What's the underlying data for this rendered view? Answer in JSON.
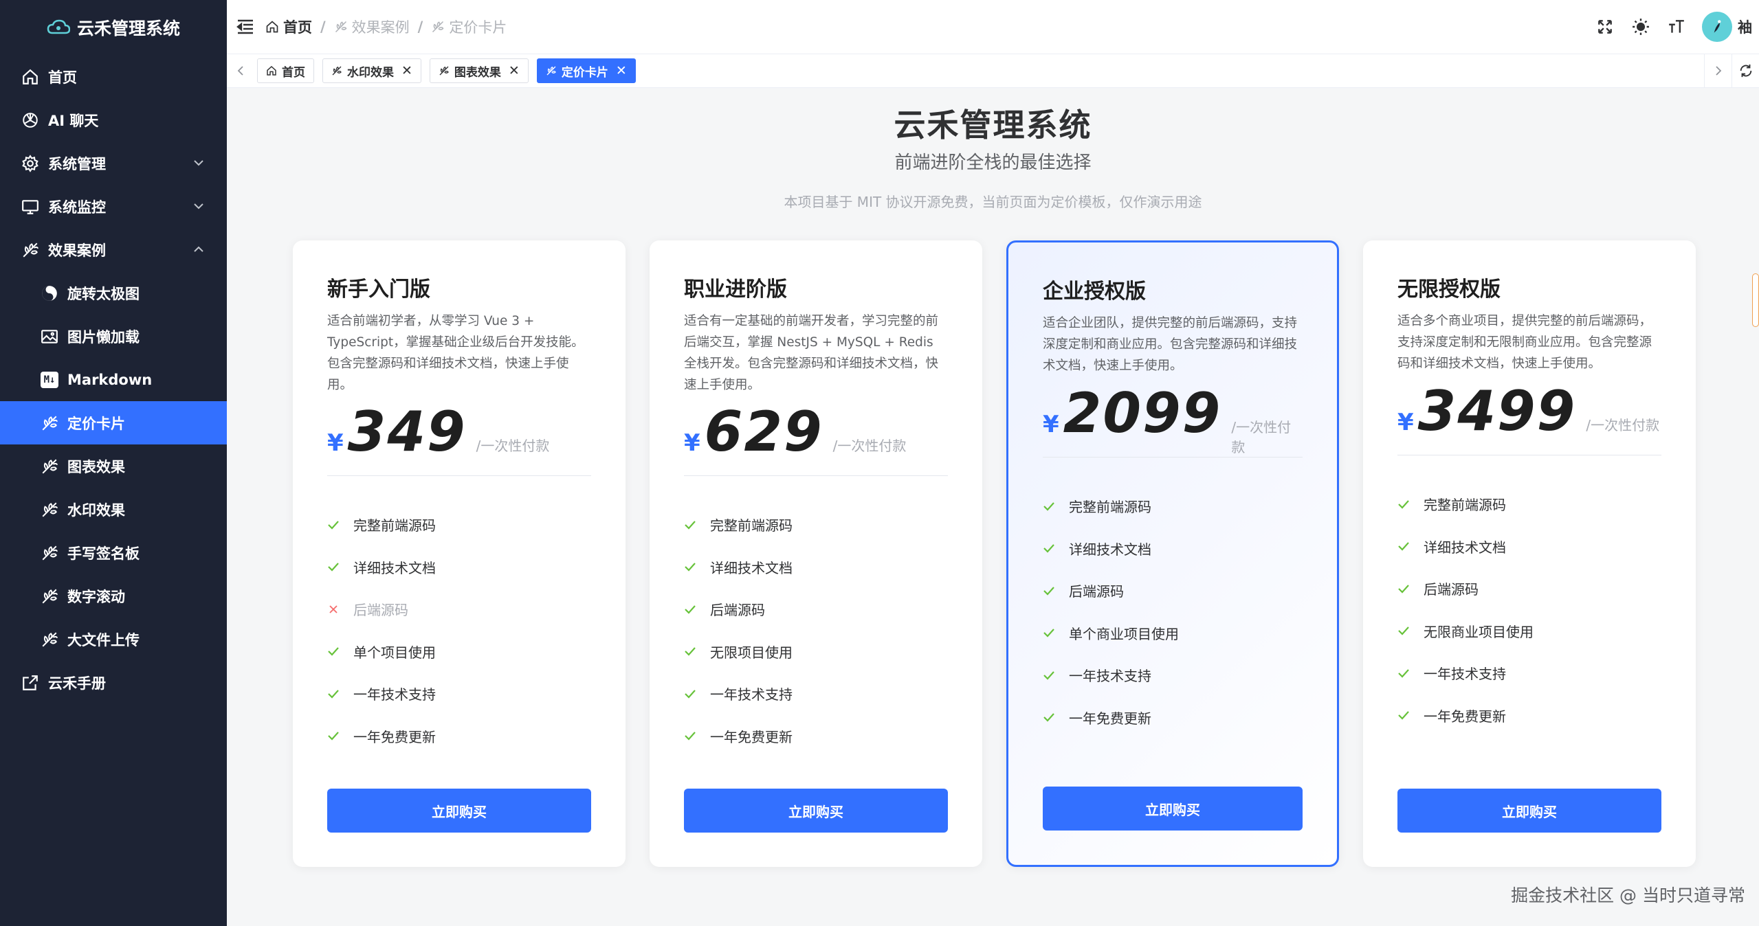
{
  "app": {
    "title": "云禾管理系统"
  },
  "sidebar": {
    "items": [
      {
        "label": "首页",
        "icon": "home-icon"
      },
      {
        "label": "AI 聊天",
        "icon": "openai-icon"
      },
      {
        "label": "系统管理",
        "icon": "gear-icon"
      },
      {
        "label": "系统监控",
        "icon": "monitor-icon"
      },
      {
        "label": "效果案例",
        "icon": "leaf-icon"
      }
    ],
    "sub_items": [
      {
        "label": "旋转太极图",
        "icon": "yin-yang-icon"
      },
      {
        "label": "图片懒加载",
        "icon": "image-icon"
      },
      {
        "label": "Markdown",
        "icon": "markdown-icon",
        "badge": "M↓"
      },
      {
        "label": "定价卡片",
        "icon": "leaf-icon"
      },
      {
        "label": "图表效果",
        "icon": "leaf-icon"
      },
      {
        "label": "水印效果",
        "icon": "leaf-icon"
      },
      {
        "label": "手写签名板",
        "icon": "leaf-icon"
      },
      {
        "label": "数字滚动",
        "icon": "leaf-icon"
      },
      {
        "label": "大文件上传",
        "icon": "leaf-icon"
      }
    ],
    "manual": {
      "label": "云禾手册",
      "icon": "external-link-icon"
    }
  },
  "header": {
    "breadcrumb": [
      "首页",
      "效果案例",
      "定价卡片"
    ],
    "breadcrumb_sep": "/",
    "user": "袖"
  },
  "tabs": [
    {
      "label": "首页",
      "closable": false
    },
    {
      "label": "水印效果",
      "closable": true
    },
    {
      "label": "图表效果",
      "closable": true
    },
    {
      "label": "定价卡片",
      "closable": true,
      "active": true
    }
  ],
  "tab_close": "✕",
  "hero": {
    "title": "云禾管理系统",
    "subtitle": "前端进阶全栈的最佳选择",
    "note": "本项目基于 MIT 协议开源免费，当前页面为定价模板，仅作演示用途"
  },
  "plans": [
    {
      "name": "新手入门版",
      "desc": "适合前端初学者，从零学习 Vue 3 + TypeScript，掌握基础企业级后台开发技能。包含完整源码和详细技术文档，快速上手使用。",
      "currency": "¥",
      "price": "349",
      "unit": "/一次性付款",
      "features": [
        {
          "text": "完整前端源码",
          "included": true
        },
        {
          "text": "详细技术文档",
          "included": true
        },
        {
          "text": "后端源码",
          "included": false
        },
        {
          "text": "单个项目使用",
          "included": true
        },
        {
          "text": "一年技术支持",
          "included": true
        },
        {
          "text": "一年免费更新",
          "included": true
        }
      ],
      "button": "立即购买"
    },
    {
      "name": "职业进阶版",
      "desc": "适合有一定基础的前端开发者，学习完整的前后端交互，掌握 NestJS + MySQL + Redis 全栈开发。包含完整源码和详细技术文档，快速上手使用。",
      "currency": "¥",
      "price": "629",
      "unit": "/一次性付款",
      "features": [
        {
          "text": "完整前端源码",
          "included": true
        },
        {
          "text": "详细技术文档",
          "included": true
        },
        {
          "text": "后端源码",
          "included": true
        },
        {
          "text": "无限项目使用",
          "included": true
        },
        {
          "text": "一年技术支持",
          "included": true
        },
        {
          "text": "一年免费更新",
          "included": true
        }
      ],
      "button": "立即购买"
    },
    {
      "name": "企业授权版",
      "desc": "适合企业团队，提供完整的前后端源码，支持深度定制和商业应用。包含完整源码和详细技术文档，快速上手使用。",
      "currency": "¥",
      "price": "2099",
      "unit": "/一次性付款",
      "features": [
        {
          "text": "完整前端源码",
          "included": true
        },
        {
          "text": "详细技术文档",
          "included": true
        },
        {
          "text": "后端源码",
          "included": true
        },
        {
          "text": "单个商业项目使用",
          "included": true
        },
        {
          "text": "一年技术支持",
          "included": true
        },
        {
          "text": "一年免费更新",
          "included": true
        }
      ],
      "button": "立即购买",
      "featured": true
    },
    {
      "name": "无限授权版",
      "desc": "适合多个商业项目，提供完整的前后端源码，支持深度定制和无限制商业应用。包含完整源码和详细技术文档，快速上手使用。",
      "currency": "¥",
      "price": "3499",
      "unit": "/一次性付款",
      "features": [
        {
          "text": "完整前端源码",
          "included": true
        },
        {
          "text": "详细技术文档",
          "included": true
        },
        {
          "text": "后端源码",
          "included": true
        },
        {
          "text": "无限商业项目使用",
          "included": true
        },
        {
          "text": "一年技术支持",
          "included": true
        },
        {
          "text": "一年免费更新",
          "included": true
        }
      ],
      "button": "立即购买"
    }
  ],
  "watermark": "掘金技术社区 @ 当时只道寻常",
  "colors": {
    "primary": "#3370ff",
    "sidebar": "#1d2334",
    "check": "#67c23a",
    "cross": "#f56c6c"
  }
}
